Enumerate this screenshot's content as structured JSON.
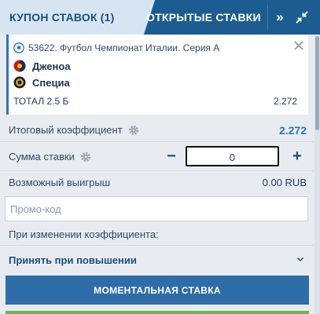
{
  "tabs": {
    "coupon_label": "КУПОН СТАВОК (1)",
    "open_bets_label": "ОТКРЫТЫЕ СТАВКИ",
    "expand_icon": "double-chevron-right-icon",
    "collapse_icon": "collapse-arrows-icon"
  },
  "bet": {
    "event": "53622. Футбол Чемпионат Италии. Серия А",
    "team_home": "Дженоа",
    "team_away": "Специа",
    "market": "ТОТАЛ 2.5 Б",
    "odd": "2.272"
  },
  "summary": {
    "total_odds_label": "Итоговый коэффициент",
    "total_odds_value": "2.272",
    "stake_label": "Сумма ставки",
    "stake_value": "0",
    "minus_label": "−",
    "plus_label": "+",
    "possible_win_label": "Возможный выигрыш",
    "possible_win_value": "0.00 RUB"
  },
  "promo": {
    "placeholder": "Промо-код"
  },
  "odds_change": {
    "label": "При изменении коэффициента:",
    "selected": "Принять при повышении"
  },
  "actions": {
    "fast_bet_label": "МОМЕНТАЛЬНАЯ СТАВКА"
  },
  "colors": {
    "accent": "#2a74c4",
    "header": "#1c5c91",
    "button": "#2f6da8",
    "confirm_strip": "#6bb84a"
  }
}
